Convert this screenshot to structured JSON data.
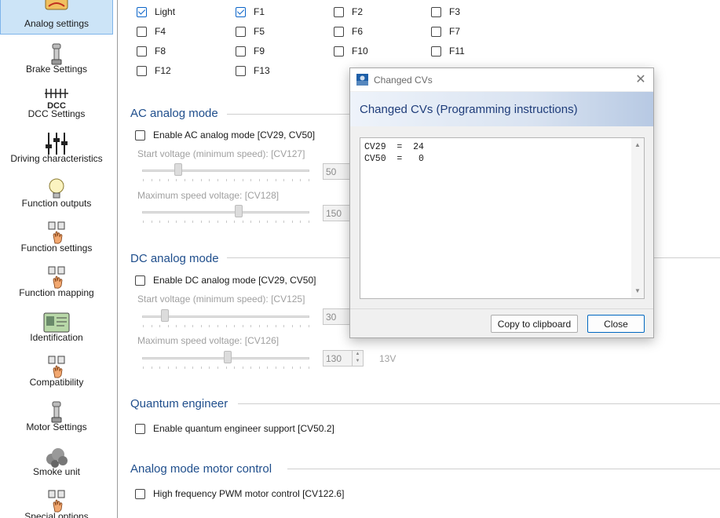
{
  "sidebar": {
    "items": [
      {
        "label": "Analog settings",
        "icon": "analog-icon",
        "selected": true
      },
      {
        "label": "Brake Settings",
        "icon": "brake-icon",
        "selected": false
      },
      {
        "label": "DCC Settings",
        "icon": "dcc-icon",
        "icon_text": "DCC",
        "selected": false
      },
      {
        "label": "Driving characteristics",
        "icon": "sliders-icon",
        "selected": false
      },
      {
        "label": "Function outputs",
        "icon": "bulb-icon",
        "selected": false
      },
      {
        "label": "Function settings",
        "icon": "function-icon",
        "selected": false
      },
      {
        "label": "Function mapping",
        "icon": "function-icon",
        "selected": false
      },
      {
        "label": "Identification",
        "icon": "id-card-icon",
        "selected": false
      },
      {
        "label": "Compatibility",
        "icon": "function-icon",
        "selected": false
      },
      {
        "label": "Motor Settings",
        "icon": "motor-icon",
        "selected": false
      },
      {
        "label": "Smoke unit",
        "icon": "smoke-icon",
        "selected": false
      },
      {
        "label": "Special options",
        "icon": "function-icon",
        "selected": false
      }
    ]
  },
  "functions": {
    "checkboxes": [
      {
        "label": "Light",
        "checked": true
      },
      {
        "label": "F1",
        "checked": true
      },
      {
        "label": "F2",
        "checked": false
      },
      {
        "label": "F3",
        "checked": false
      },
      {
        "label": "F4",
        "checked": false
      },
      {
        "label": "F5",
        "checked": false
      },
      {
        "label": "F6",
        "checked": false
      },
      {
        "label": "F7",
        "checked": false
      },
      {
        "label": "F8",
        "checked": false
      },
      {
        "label": "F9",
        "checked": false
      },
      {
        "label": "F10",
        "checked": false
      },
      {
        "label": "F11",
        "checked": false
      },
      {
        "label": "F12",
        "checked": false
      },
      {
        "label": "F13",
        "checked": false
      }
    ]
  },
  "ac": {
    "title": "AC analog mode",
    "enable_label": "Enable AC analog mode [CV29, CV50]",
    "enabled": false,
    "start_label": "Start voltage (minimum speed): [CV127]",
    "start_value": "50",
    "start_level": 0.2,
    "max_label": "Maximum speed voltage: [CV128]",
    "max_value": "150",
    "max_level": 0.58
  },
  "dc": {
    "title": "DC analog mode",
    "enable_label": "Enable DC analog mode [CV29, CV50]",
    "enabled": false,
    "start_label": "Start voltage (minimum speed): [CV125]",
    "start_value": "30",
    "start_level": 0.12,
    "max_label": "Maximum speed voltage: [CV126]",
    "max_value": "130",
    "max_level": 0.51,
    "max_unit": "13V"
  },
  "quantum": {
    "title": "Quantum engineer",
    "enable_label": "Enable quantum engineer support [CV50.2]",
    "enabled": false
  },
  "motor_control": {
    "title": "Analog mode motor control",
    "pwm_label": "High frequency PWM motor control [CV122.6]",
    "enabled": false
  },
  "dialog": {
    "window_title": "Changed CVs",
    "heading": "Changed CVs (Programming instructions)",
    "cv_lines": [
      "CV29  =  24",
      "CV50  =   0"
    ],
    "copy_label": "Copy to clipboard",
    "close_label": "Close",
    "accent": "#0067c0"
  }
}
